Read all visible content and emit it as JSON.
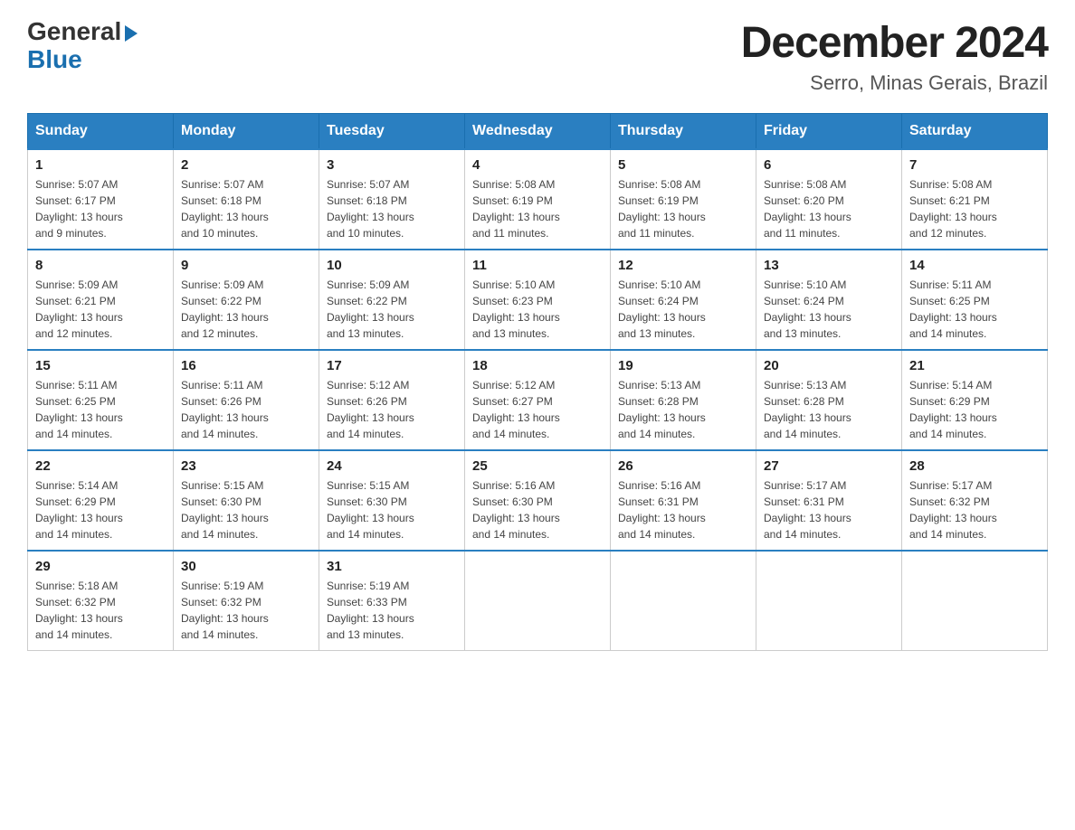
{
  "logo": {
    "general": "General",
    "blue": "Blue"
  },
  "title": "December 2024",
  "subtitle": "Serro, Minas Gerais, Brazil",
  "weekdays": [
    "Sunday",
    "Monday",
    "Tuesday",
    "Wednesday",
    "Thursday",
    "Friday",
    "Saturday"
  ],
  "weeks": [
    [
      {
        "day": "1",
        "sunrise": "5:07 AM",
        "sunset": "6:17 PM",
        "daylight": "13 hours and 9 minutes."
      },
      {
        "day": "2",
        "sunrise": "5:07 AM",
        "sunset": "6:18 PM",
        "daylight": "13 hours and 10 minutes."
      },
      {
        "day": "3",
        "sunrise": "5:07 AM",
        "sunset": "6:18 PM",
        "daylight": "13 hours and 10 minutes."
      },
      {
        "day": "4",
        "sunrise": "5:08 AM",
        "sunset": "6:19 PM",
        "daylight": "13 hours and 11 minutes."
      },
      {
        "day": "5",
        "sunrise": "5:08 AM",
        "sunset": "6:19 PM",
        "daylight": "13 hours and 11 minutes."
      },
      {
        "day": "6",
        "sunrise": "5:08 AM",
        "sunset": "6:20 PM",
        "daylight": "13 hours and 11 minutes."
      },
      {
        "day": "7",
        "sunrise": "5:08 AM",
        "sunset": "6:21 PM",
        "daylight": "13 hours and 12 minutes."
      }
    ],
    [
      {
        "day": "8",
        "sunrise": "5:09 AM",
        "sunset": "6:21 PM",
        "daylight": "13 hours and 12 minutes."
      },
      {
        "day": "9",
        "sunrise": "5:09 AM",
        "sunset": "6:22 PM",
        "daylight": "13 hours and 12 minutes."
      },
      {
        "day": "10",
        "sunrise": "5:09 AM",
        "sunset": "6:22 PM",
        "daylight": "13 hours and 13 minutes."
      },
      {
        "day": "11",
        "sunrise": "5:10 AM",
        "sunset": "6:23 PM",
        "daylight": "13 hours and 13 minutes."
      },
      {
        "day": "12",
        "sunrise": "5:10 AM",
        "sunset": "6:24 PM",
        "daylight": "13 hours and 13 minutes."
      },
      {
        "day": "13",
        "sunrise": "5:10 AM",
        "sunset": "6:24 PM",
        "daylight": "13 hours and 13 minutes."
      },
      {
        "day": "14",
        "sunrise": "5:11 AM",
        "sunset": "6:25 PM",
        "daylight": "13 hours and 14 minutes."
      }
    ],
    [
      {
        "day": "15",
        "sunrise": "5:11 AM",
        "sunset": "6:25 PM",
        "daylight": "13 hours and 14 minutes."
      },
      {
        "day": "16",
        "sunrise": "5:11 AM",
        "sunset": "6:26 PM",
        "daylight": "13 hours and 14 minutes."
      },
      {
        "day": "17",
        "sunrise": "5:12 AM",
        "sunset": "6:26 PM",
        "daylight": "13 hours and 14 minutes."
      },
      {
        "day": "18",
        "sunrise": "5:12 AM",
        "sunset": "6:27 PM",
        "daylight": "13 hours and 14 minutes."
      },
      {
        "day": "19",
        "sunrise": "5:13 AM",
        "sunset": "6:28 PM",
        "daylight": "13 hours and 14 minutes."
      },
      {
        "day": "20",
        "sunrise": "5:13 AM",
        "sunset": "6:28 PM",
        "daylight": "13 hours and 14 minutes."
      },
      {
        "day": "21",
        "sunrise": "5:14 AM",
        "sunset": "6:29 PM",
        "daylight": "13 hours and 14 minutes."
      }
    ],
    [
      {
        "day": "22",
        "sunrise": "5:14 AM",
        "sunset": "6:29 PM",
        "daylight": "13 hours and 14 minutes."
      },
      {
        "day": "23",
        "sunrise": "5:15 AM",
        "sunset": "6:30 PM",
        "daylight": "13 hours and 14 minutes."
      },
      {
        "day": "24",
        "sunrise": "5:15 AM",
        "sunset": "6:30 PM",
        "daylight": "13 hours and 14 minutes."
      },
      {
        "day": "25",
        "sunrise": "5:16 AM",
        "sunset": "6:30 PM",
        "daylight": "13 hours and 14 minutes."
      },
      {
        "day": "26",
        "sunrise": "5:16 AM",
        "sunset": "6:31 PM",
        "daylight": "13 hours and 14 minutes."
      },
      {
        "day": "27",
        "sunrise": "5:17 AM",
        "sunset": "6:31 PM",
        "daylight": "13 hours and 14 minutes."
      },
      {
        "day": "28",
        "sunrise": "5:17 AM",
        "sunset": "6:32 PM",
        "daylight": "13 hours and 14 minutes."
      }
    ],
    [
      {
        "day": "29",
        "sunrise": "5:18 AM",
        "sunset": "6:32 PM",
        "daylight": "13 hours and 14 minutes."
      },
      {
        "day": "30",
        "sunrise": "5:19 AM",
        "sunset": "6:32 PM",
        "daylight": "13 hours and 14 minutes."
      },
      {
        "day": "31",
        "sunrise": "5:19 AM",
        "sunset": "6:33 PM",
        "daylight": "13 hours and 13 minutes."
      },
      null,
      null,
      null,
      null
    ]
  ],
  "colors": {
    "header_bg": "#2a7fc1",
    "header_text": "#ffffff",
    "border": "#ccc",
    "accent": "#1a6faf"
  }
}
